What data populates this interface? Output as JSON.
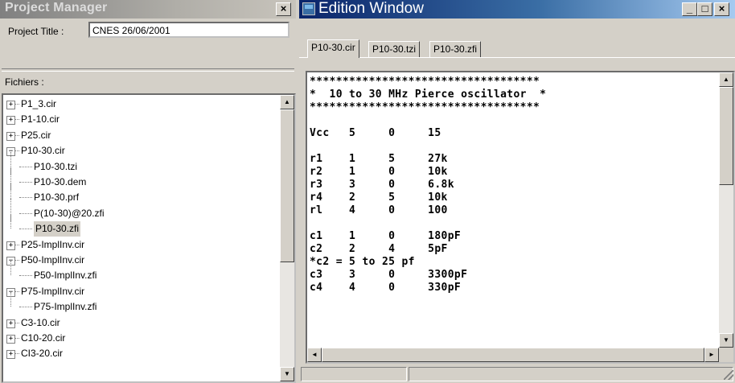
{
  "project_manager": {
    "title": "Project Manager",
    "close_glyph": "×",
    "project_title_label": "Project Title :",
    "project_title_value": "CNES 26/06/2001",
    "files_label": "Fichiers :",
    "tree": [
      {
        "label": "P1_3.cir",
        "expander": "+"
      },
      {
        "label": "P1-10.cir",
        "expander": "+"
      },
      {
        "label": "P25.cir",
        "expander": "+"
      },
      {
        "label": "P10-30.cir",
        "expander": "−"
      },
      {
        "label": "P10-30.tzi"
      },
      {
        "label": "P10-30.dem"
      },
      {
        "label": "P10-30.prf"
      },
      {
        "label": "P(10-30)@20.zfi"
      },
      {
        "label": "P10-30.zfi",
        "selected": true
      },
      {
        "label": "P25-ImplInv.cir",
        "expander": "+"
      },
      {
        "label": "P50-ImplInv.cir",
        "expander": "−"
      },
      {
        "label": "P50-ImplInv.zfi"
      },
      {
        "label": "P75-ImplInv.cir",
        "expander": "−"
      },
      {
        "label": "P75-ImplInv.zfi"
      },
      {
        "label": "C3-10.cir",
        "expander": "+"
      },
      {
        "label": "C10-20.cir",
        "expander": "+"
      },
      {
        "label": "CI3-20.cir",
        "expander": "+"
      }
    ]
  },
  "edition_window": {
    "title": "Edition Window",
    "min_glyph": "_",
    "max_glyph": "□",
    "close_glyph": "×",
    "tabs": [
      {
        "label": "P10-30.cir",
        "active": true
      },
      {
        "label": "P10-30.tzi"
      },
      {
        "label": "P10-30.zfi"
      }
    ],
    "code_lines": [
      "***********************************",
      "*  10 to 30 MHz Pierce oscillator  *",
      "***********************************",
      "",
      "Vcc   5     0     15",
      "",
      "r1    1     5     27k",
      "r2    1     0     10k",
      "r3    3     0     6.8k",
      "r4    2     5     10k",
      "rl    4     0     100",
      "",
      "c1    1     0     180pF",
      "c2    2     4     5pF",
      "*c2 = 5 to 25 pf",
      "c3    3     0     3300pF",
      "c4    4     0     330pF"
    ]
  },
  "scroll_glyphs": {
    "up": "▲",
    "down": "▼",
    "left": "◄",
    "right": "►"
  },
  "colors": {
    "active_title": "#0a246a",
    "inactive_title": "#808080",
    "face": "#d4d0c8"
  }
}
